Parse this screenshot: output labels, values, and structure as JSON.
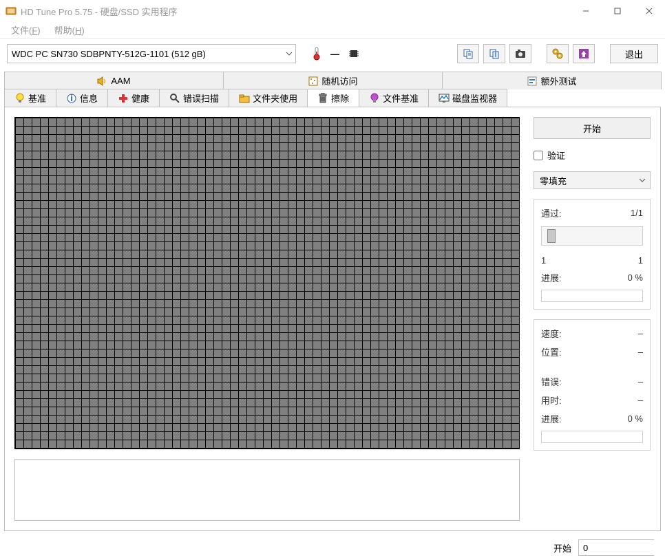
{
  "window": {
    "title": "HD Tune Pro 5.75 - 硬盘/SSD 实用程序"
  },
  "menu": {
    "file": "文件(F)",
    "help": "帮助(H)"
  },
  "toolbar": {
    "drive": "WDC PC SN730 SDBPNTY-512G-1101 (512 gB)",
    "temp_dash": "—",
    "exit": "退出"
  },
  "tabs": {
    "aam": "AAM",
    "random": "随机访问",
    "extra": "额外测试",
    "benchmark": "基准",
    "info": "信息",
    "health": "健康",
    "errorscan": "错误扫描",
    "folder": "文件夹使用",
    "erase": "擦除",
    "filebench": "文件基准",
    "diskmon": "磁盘监视器"
  },
  "side": {
    "start": "开始",
    "verify": "验证",
    "fillmode": "零填充",
    "pass_label": "通过:",
    "pass_value": "1/1",
    "range_from": "1",
    "range_to": "1",
    "progress_label": "进展:",
    "progress_value": "0 %",
    "speed_label": "速度:",
    "speed_value": "–",
    "position_label": "位置:",
    "position_value": "–",
    "error_label": "错误:",
    "error_value": "–",
    "elapsed_label": "用时:",
    "elapsed_value": "–",
    "progress2_label": "进展:",
    "progress2_value": "0 %"
  },
  "footer": {
    "start_label": "开始",
    "start_value": "0"
  }
}
